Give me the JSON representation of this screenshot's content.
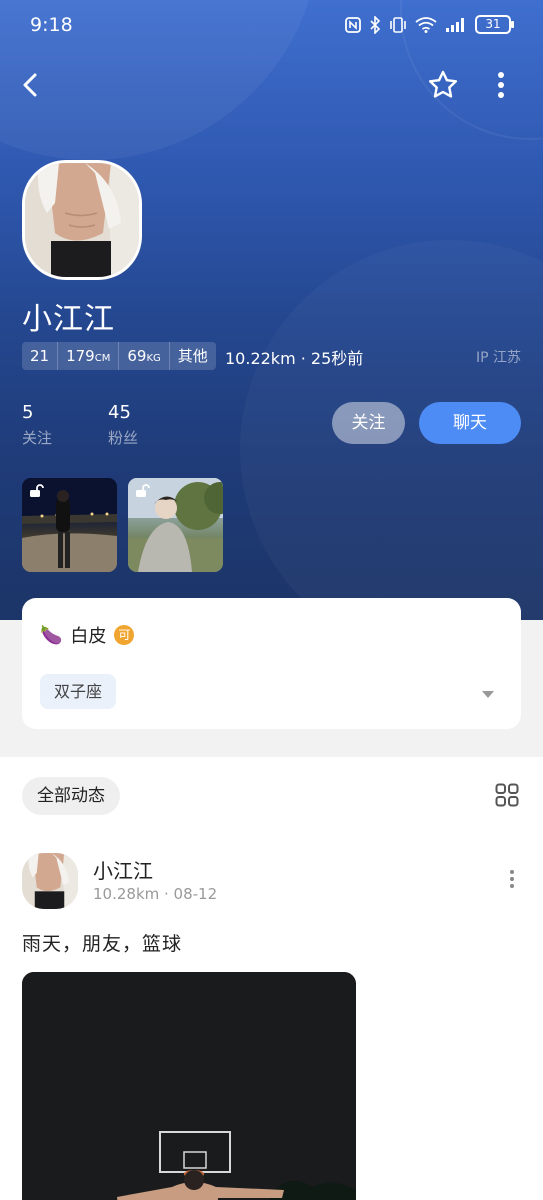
{
  "status_bar": {
    "time": "9:18",
    "battery": "31"
  },
  "header": {
    "back_icon": "chevron-left-icon",
    "favorite_icon": "star-outline-icon",
    "more_icon": "more-vertical-icon"
  },
  "profile": {
    "name": "小江江",
    "age": "21",
    "height_value": "179",
    "height_unit": "CM",
    "weight_value": "69",
    "weight_unit": "KG",
    "role": "其他",
    "distance_time": "10.22km · 25秒前",
    "ip_location": "IP 江苏",
    "following_count": "5",
    "following_label": "关注",
    "fans_count": "45",
    "fans_label": "粉丝",
    "follow_button": "关注",
    "chat_button": "聊天"
  },
  "info_card": {
    "emoji": "🍆",
    "title": "白皮",
    "badge": "可",
    "tags": [
      "双子座"
    ]
  },
  "feed": {
    "filter_label": "全部动态",
    "post": {
      "author": "小江江",
      "meta": "10.28km · 08-12",
      "text": "雨天，朋友，篮球"
    }
  },
  "colors": {
    "accent": "#4e8cf5",
    "badge": "#f0a531",
    "hero_top": "#3f6fcf",
    "hero_bottom": "#1c3568"
  }
}
